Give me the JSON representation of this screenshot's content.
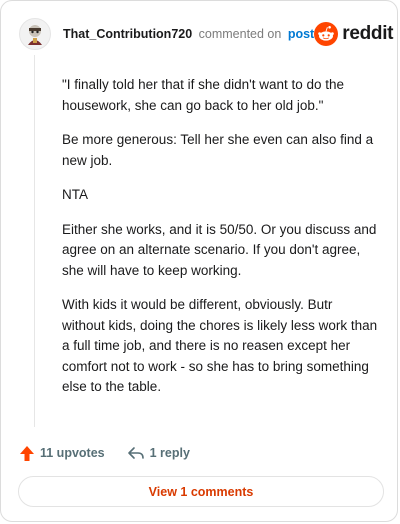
{
  "header": {
    "username": "That_Contribution720",
    "action": "commented on",
    "post_link": "post",
    "brand": "reddit"
  },
  "comment": {
    "paragraphs": [
      "\"I finally told her that if she didn't want to do the housework, she can go back to her old job.\"",
      "Be more generous: Tell her she even can also find a new job.",
      "NTA",
      "Either she works, and it is 50/50. Or you discuss and agree on an alternate scenario. If you don't agree, she will have to keep working.",
      "With kids it would be different, obviously. Butr without kids, doing the chores is likely less work than a full time job, and there is no reasen except her comfort not to work - so she has to bring something else to the table."
    ]
  },
  "actions": {
    "upvotes": "11 upvotes",
    "replies": "1 reply"
  },
  "footer": {
    "view_comments": "View 1 comments"
  },
  "colors": {
    "accent": "#ff4500",
    "link": "#0079d3",
    "view_button_text": "#d93a00"
  },
  "icons": [
    "avatar",
    "reddit-logo-icon",
    "upvote-arrow-icon",
    "reply-icon"
  ]
}
